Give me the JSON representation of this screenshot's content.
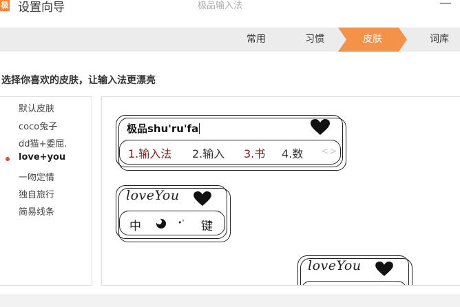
{
  "window": {
    "icon_glyph": "极",
    "title": "设置向导",
    "app_name": "极品输入法",
    "close_glyph": "—"
  },
  "tabs": [
    {
      "label": "常用",
      "active": false
    },
    {
      "label": "习惯",
      "active": false
    },
    {
      "label": "皮肤",
      "active": true
    },
    {
      "label": "词库",
      "active": false
    }
  ],
  "heading": "选择你喜欢的皮肤，让输入法更漂亮",
  "skins": [
    {
      "label": "默认皮肤",
      "selected": false
    },
    {
      "label": "coco兔子",
      "selected": false
    },
    {
      "label": "dd猫+委屈.",
      "selected": false
    },
    {
      "label": "love+you",
      "selected": true
    },
    {
      "label": "一吻定情",
      "selected": false
    },
    {
      "label": "独自旅行",
      "selected": false
    },
    {
      "label": "简易线条",
      "selected": false
    }
  ],
  "preview": {
    "composition": "极品shu'ru'fa",
    "candidates": [
      "1.输入法",
      "2.输入",
      "3.书",
      "4.数"
    ],
    "page_arrows": "<>",
    "toolbar_text": "loveYou",
    "toolbar_chinese": "中",
    "toolbar_punct": "•'",
    "toolbar_keyboard": "键"
  },
  "colors": {
    "accent": "#f5924a",
    "candidate": "#8b1a1a",
    "bullet": "#e04a3a"
  },
  "icons": [
    "heart-icon",
    "moon-icon",
    "close-icon"
  ]
}
